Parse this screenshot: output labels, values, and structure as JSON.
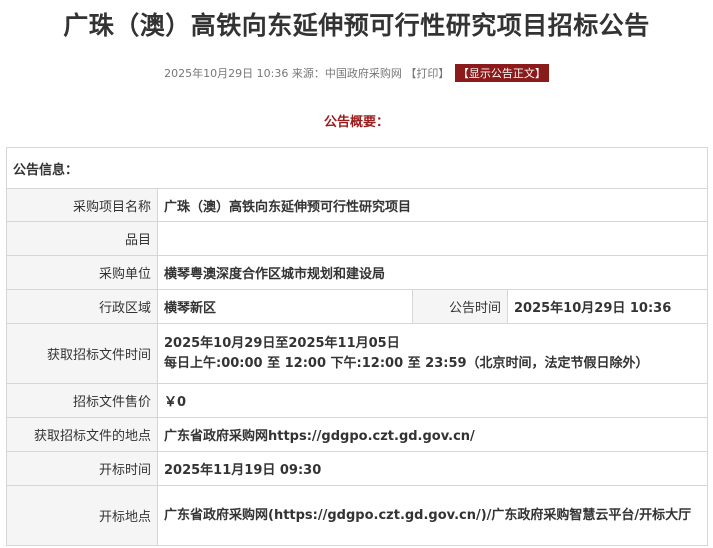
{
  "title": "广珠（澳）高铁向东延伸预可行性研究项目招标公告",
  "meta": {
    "datetime": "2025年10月29日 10:36",
    "source_label": "来源：",
    "source": "中国政府采购网",
    "print": "【打印】",
    "show_text": "【显示公告正文】"
  },
  "overview_heading": "公告概要：",
  "section_label": "公告信息：",
  "rows": {
    "project_name": {
      "label": "采购项目名称",
      "value": "广珠（澳）高铁向东延伸预可行性研究项目"
    },
    "category": {
      "label": "品目",
      "value": ""
    },
    "purchaser": {
      "label": "采购单位",
      "value": "横琴粤澳深度合作区城市规划和建设局"
    },
    "region": {
      "label": "行政区域",
      "value": "横琴新区"
    },
    "announce_time": {
      "label": "公告时间",
      "value": "2025年10月29日 10:36"
    },
    "doc_time": {
      "label": "获取招标文件时间",
      "line1": "2025年10月29日至2025年11月05日",
      "line2": "每日上午:00:00 至 12:00  下午:12:00 至 23:59（北京时间，法定节假日除外）"
    },
    "price": {
      "label": "招标文件售价",
      "value": "￥0"
    },
    "doc_place": {
      "label": "获取招标文件的地点",
      "value": "广东省政府采购网https://gdgpo.czt.gd.gov.cn/"
    },
    "open_time": {
      "label": "开标时间",
      "value": "2025年11月19日 09:30"
    },
    "open_place": {
      "label": "开标地点",
      "value": "广东省政府采购网(https://gdgpo.czt.gd.gov.cn/)/广东政府采购智慧云平台/开标大厅"
    }
  }
}
